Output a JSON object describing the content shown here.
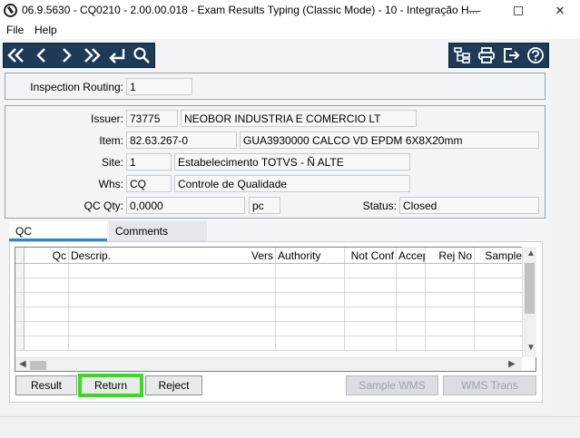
{
  "window": {
    "title": "06.9.5630 - CQ0210 - 2.00.00.018 - Exam Results Typing (Classic Mode) - 10 - Integração H...",
    "minimize": "—",
    "close": "✕"
  },
  "menu": {
    "file": "File",
    "help": "Help"
  },
  "toolbar": {
    "nav_icons": [
      "first-record-icon",
      "previous-record-icon",
      "next-record-icon",
      "last-record-icon",
      "return-icon",
      "search-icon"
    ],
    "right_icons": [
      "tree-icon",
      "print-icon",
      "exit-icon",
      "help-icon"
    ]
  },
  "routing": {
    "label": "Inspection Routing:",
    "value": "1"
  },
  "header": {
    "issuer_label": "Issuer:",
    "issuer_code": "73775",
    "issuer_name": "NEOBOR INDUSTRIA E COMERCIO LT",
    "item_label": "Item:",
    "item_code": "82.63.267-0",
    "item_desc": "GUA3930000 CALCO VD EPDM 6X8X20mm",
    "site_label": "Site:",
    "site_code": "1",
    "site_name": "Estabelecimento TOTVS - Ñ ALTE",
    "whs_label": "Whs:",
    "whs_code": "CQ",
    "whs_name": "Controle de Qualidade",
    "qcqty_label": "QC Qty:",
    "qcqty_value": "0,0000",
    "qcqty_unit": "pc",
    "status_label": "Status:",
    "status_value": "Closed"
  },
  "tabs": {
    "qc": "QC",
    "comments": "Comments"
  },
  "grid": {
    "columns": [
      "Qc",
      "Descrip.",
      "Vers",
      "Authority",
      "Not Conf",
      "Accept",
      "Rej No",
      "Sample"
    ],
    "row_count": 6
  },
  "buttons": {
    "result": "Result",
    "return": "Return",
    "reject": "Reject",
    "sample_wms": "Sample WMS",
    "wms_trans": "WMS Trans"
  },
  "colors": {
    "toolbar": "#1d3a57",
    "highlight": "#32e016",
    "tab_accent": "#2a87d0"
  }
}
